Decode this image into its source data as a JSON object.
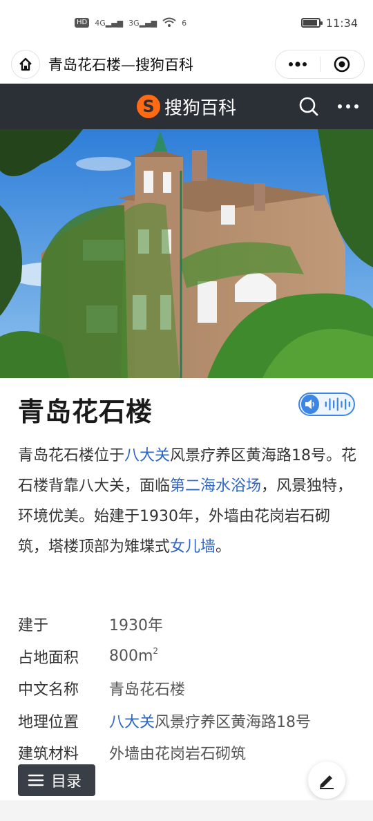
{
  "status_bar": {
    "hd_badge": "HD",
    "signal_1": "4G",
    "signal_2": "3G",
    "wifi": "6",
    "time": "11:34",
    "battery_level": 0.9
  },
  "titlebar": {
    "title": "青岛花石楼—搜狗百科",
    "home_icon": "home-icon",
    "more_icon": "more-dots-icon",
    "close_icon": "target-close-icon"
  },
  "header": {
    "brand_mark": "S",
    "brand_name": "搜狗百科",
    "search_icon": "search-icon",
    "more_icon": "more-dots-icon"
  },
  "entry": {
    "title": "青岛花石楼",
    "audio_icon": "speaker-wave-icon"
  },
  "summary": {
    "p1": "青岛花石楼位于",
    "link1": "八大关",
    "p2": "风景疗养区黄海路18号。花石楼背靠八大关，面临",
    "link2": "第二海水浴场",
    "p3": "，风景独特，环境优美。始建于1930年，外墙由花岗岩石砌筑，塔楼顶部为雉堞式",
    "link3": "女儿墙",
    "p4": "。"
  },
  "infobox": {
    "built_label": "建于",
    "built_value": "1930年",
    "area_label": "占地面积",
    "area_value": "800m",
    "area_sup": "2",
    "cn_name_label": "中文名称",
    "cn_name_value": "青岛花石楼",
    "location_label": "地理位置",
    "location_link": "八大关",
    "location_rest": "风景疗养区黄海路18号",
    "material_label": "建筑材料",
    "material_value": "外墙由花岗岩石砌筑"
  },
  "toc": {
    "label": "目录",
    "icon": "list-icon"
  },
  "edit": {
    "icon": "pencil-icon"
  },
  "colors": {
    "header_bg": "#2b2f36",
    "brand_orange": "#ff6a13",
    "link_blue": "#2f66c4",
    "toc_bg": "#3a3f47"
  }
}
